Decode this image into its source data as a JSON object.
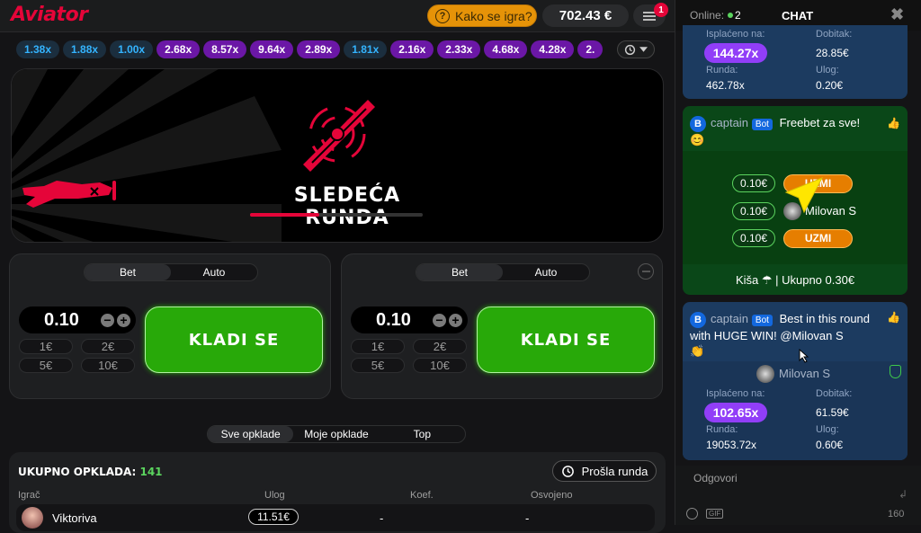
{
  "header": {
    "logo": "Aviator",
    "how_to_play": "Kako se igra?",
    "balance": "702.43 €",
    "menu_badge": "1"
  },
  "multipliers": [
    {
      "value": "1.38x",
      "color": "blue"
    },
    {
      "value": "1.88x",
      "color": "blue"
    },
    {
      "value": "1.00x",
      "color": "blue"
    },
    {
      "value": "2.68x",
      "color": "purple"
    },
    {
      "value": "8.57x",
      "color": "purple"
    },
    {
      "value": "9.64x",
      "color": "purple"
    },
    {
      "value": "2.89x",
      "color": "purple"
    },
    {
      "value": "1.81x",
      "color": "blue"
    },
    {
      "value": "2.16x",
      "color": "purple"
    },
    {
      "value": "2.33x",
      "color": "purple"
    },
    {
      "value": "4.68x",
      "color": "purple"
    },
    {
      "value": "4.28x",
      "color": "purple"
    },
    {
      "value": "2.",
      "color": "purple"
    }
  ],
  "stage": {
    "next_round": "SLEDEĆA RUNDA",
    "progress": 0.4
  },
  "bet_panels": [
    {
      "tab_bet": "Bet",
      "tab_auto": "Auto",
      "amount": "0.10",
      "quick": [
        "1€",
        "2€",
        "5€",
        "10€"
      ],
      "button": "KLADI SE"
    },
    {
      "tab_bet": "Bet",
      "tab_auto": "Auto",
      "amount": "0.10",
      "quick": [
        "1€",
        "2€",
        "5€",
        "10€"
      ],
      "button": "KLADI SE"
    }
  ],
  "bets_tabs": [
    "Sve opklade",
    "Moje opklade",
    "Top"
  ],
  "bets": {
    "total_label": "UKUPNO OPKLADA:",
    "total_count": "141",
    "previous_round": "Prošla runda",
    "columns": [
      "Igrač",
      "Ulog",
      "Koef.",
      "Osvojeno"
    ],
    "rows": [
      {
        "name": "Viktoriva",
        "stake": "11.51€",
        "coef": "-",
        "won": "-"
      }
    ]
  },
  "chat": {
    "online_label": "Online:",
    "online_count": "2",
    "title": "CHAT",
    "card1": {
      "paid_label": "Isplaćeno na:",
      "paid_value": "144.27x",
      "win_label": "Dobitak:",
      "win_value": "28.85€",
      "round_label": "Runda:",
      "round_value": "462.78x",
      "stake_label": "Ulog:",
      "stake_value": "0.20€"
    },
    "message1": {
      "user": "captain",
      "badge": "Bot",
      "text": "Freebet za sve!",
      "emoji": "😊",
      "offers": [
        {
          "amount": "0.10€",
          "action": "UZMI",
          "taken_by": ""
        },
        {
          "amount": "0.10€",
          "action": "",
          "taken_by": "Milovan S"
        },
        {
          "amount": "0.10€",
          "action": "UZMI",
          "taken_by": ""
        }
      ],
      "footer": "Kiša ☂ | Ukupno 0.30€"
    },
    "message2": {
      "user": "captain",
      "badge": "Bot",
      "text": "Best in this round with HUGE WIN! @Milovan S",
      "emoji": "👏",
      "winner": "Milovan S",
      "paid_label": "Isplaćeno na:",
      "paid_value": "102.65x",
      "win_label": "Dobitak:",
      "win_value": "61.59€",
      "round_label": "Runda:",
      "round_value": "19053.72x",
      "stake_label": "Ulog:",
      "stake_value": "0.60€"
    },
    "reply_placeholder": "Odgovori",
    "gif_label": "GIF",
    "char_count": "160"
  }
}
